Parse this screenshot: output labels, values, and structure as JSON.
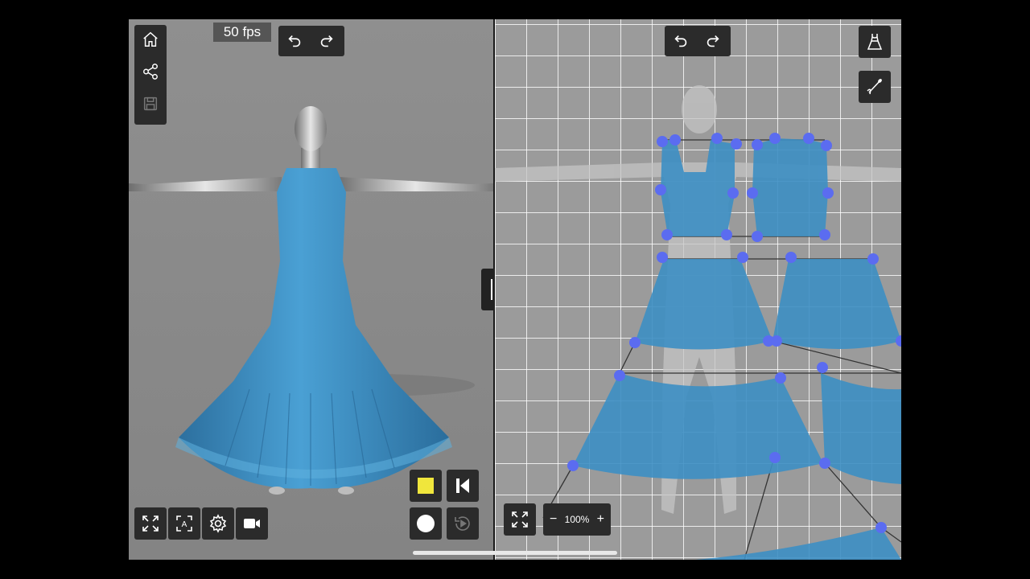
{
  "toolbar_left": {
    "icons": [
      "home-icon",
      "share-icon",
      "save-icon"
    ],
    "fps": "50 fps",
    "undo_icon": "undo-icon",
    "redo_icon": "redo-icon"
  },
  "toolbar_right": {
    "undo_icon": "undo-icon",
    "redo_icon": "redo-icon",
    "dress_icon": "dress-icon",
    "needle_icon": "needle-icon"
  },
  "bottom_left": {
    "icons": [
      "fullscreen-icon",
      "auto-fit-icon",
      "settings-icon",
      "video-camera-icon"
    ]
  },
  "playback": {
    "icons": [
      "stop-icon",
      "skip-back-icon",
      "record-icon",
      "replay-icon"
    ],
    "stop_color": "#f0e63c"
  },
  "pattern_view": {
    "fit_icon": "fullscreen-icon",
    "zoom_out": "−",
    "zoom_level": "100%",
    "zoom_in": "+"
  },
  "colors": {
    "fabric": "#3d8fc4",
    "pin": "#5b6cf0",
    "panel": "#2b2b2b",
    "grid": "#ffffff"
  }
}
